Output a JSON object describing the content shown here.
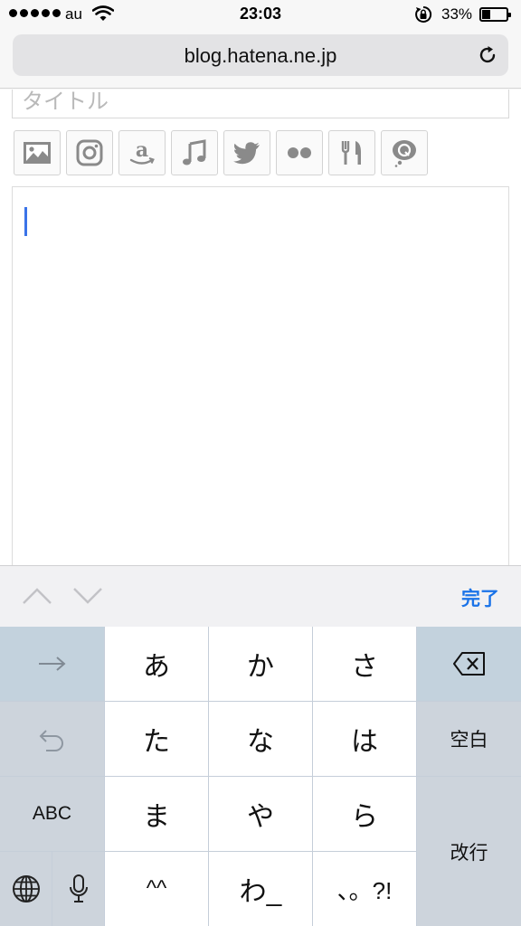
{
  "status_bar": {
    "carrier": "au",
    "time": "23:03",
    "battery_percent": "33%",
    "battery_level": 0.33
  },
  "browser": {
    "url": "blog.hatena.ne.jp"
  },
  "editor": {
    "title_placeholder": "タイトル",
    "toolbar_icons": [
      "image-icon",
      "instagram-icon",
      "amazon-icon",
      "music-icon",
      "twitter-icon",
      "flickr-icon",
      "restaurant-icon",
      "hatena-question-icon"
    ]
  },
  "accessory_bar": {
    "done_label": "完了"
  },
  "keyboard": {
    "row1": [
      "あ",
      "か",
      "さ"
    ],
    "row2": [
      "た",
      "な",
      "は"
    ],
    "row3": [
      "ま",
      "や",
      "ら"
    ],
    "row4": [
      "^^",
      "わ_",
      "、。?!"
    ],
    "abc": "ABC",
    "space": "空白",
    "enter": "改行"
  }
}
